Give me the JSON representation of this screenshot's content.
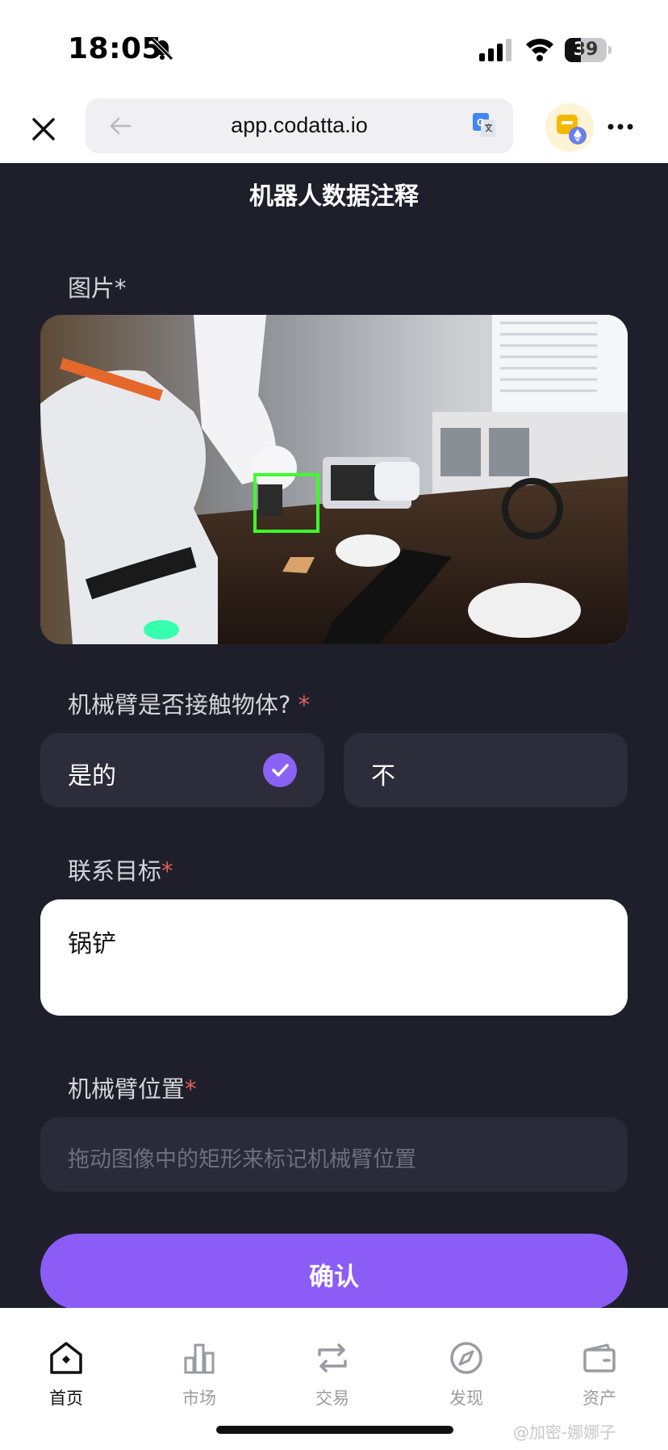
{
  "status_bar": {
    "time": "18:05",
    "battery": "39",
    "battery_level": 0.39
  },
  "browser": {
    "url": "app.codatta.io"
  },
  "page": {
    "title": "机器人数据注释"
  },
  "form": {
    "image_label": "图片",
    "image_required": "*",
    "contact_question": "机械臂是否接触物体?",
    "contact_required": "*",
    "options": {
      "yes": "是的",
      "no": "不",
      "selected": "yes"
    },
    "target_label": "联系目标",
    "target_required": "*",
    "target_value": "锅铲",
    "position_label": "机械臂位置",
    "position_required": "*",
    "position_placeholder": "拖动图像中的矩形来标记机械臂位置",
    "confirm_label": "确认"
  },
  "bottom_nav": {
    "items": [
      {
        "label": "首页",
        "icon": "home-icon",
        "active": true
      },
      {
        "label": "市场",
        "icon": "market-icon",
        "active": false
      },
      {
        "label": "交易",
        "icon": "trade-icon",
        "active": false
      },
      {
        "label": "发现",
        "icon": "discover-icon",
        "active": false
      },
      {
        "label": "资产",
        "icon": "assets-icon",
        "active": false
      }
    ]
  },
  "watermark": "@加密-娜娜子",
  "colors": {
    "background": "#1f1f2b",
    "accent": "#8b5cf6",
    "required": "#e0605c",
    "bbox": "#3cff2a"
  }
}
